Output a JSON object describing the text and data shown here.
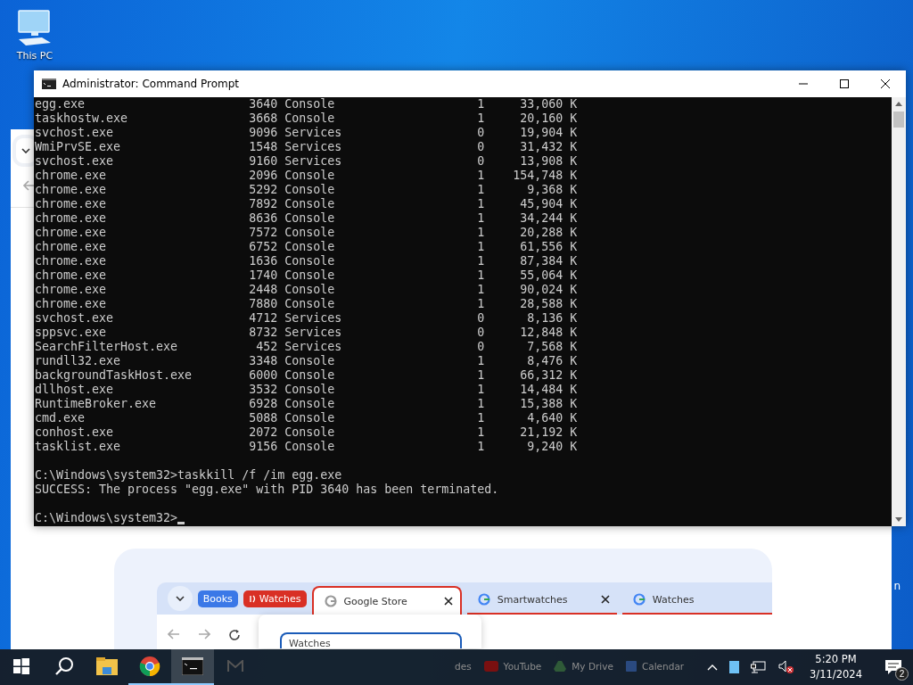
{
  "desktop": {
    "icons": [
      {
        "label": "This PC"
      }
    ]
  },
  "browser": {
    "page": {
      "tab_groups": [
        {
          "label": "Books",
          "color": "#3b78e7"
        },
        {
          "label": "Watches",
          "color": "#d93025"
        }
      ],
      "tabs": [
        {
          "title": "Google Store",
          "selected": true
        },
        {
          "title": "Smartwatches",
          "selected": false
        },
        {
          "title": "Watches",
          "selected": false
        }
      ],
      "popup_field": {
        "value": "Watches"
      },
      "bookmarks": [
        {
          "label": "des"
        },
        {
          "label": "YouTube"
        },
        {
          "label": "My Drive"
        },
        {
          "label": "Calendar"
        }
      ]
    },
    "edge_text": "n"
  },
  "cmd": {
    "title": "Administrator: Command Prompt",
    "processes": [
      {
        "name": "egg.exe",
        "pid": "3640",
        "session": "Console",
        "session_num": "1",
        "mem": "33,060 K"
      },
      {
        "name": "taskhostw.exe",
        "pid": "3668",
        "session": "Console",
        "session_num": "1",
        "mem": "20,160 K"
      },
      {
        "name": "svchost.exe",
        "pid": "9096",
        "session": "Services",
        "session_num": "0",
        "mem": "19,904 K"
      },
      {
        "name": "WmiPrvSE.exe",
        "pid": "1548",
        "session": "Services",
        "session_num": "0",
        "mem": "31,432 K"
      },
      {
        "name": "svchost.exe",
        "pid": "9160",
        "session": "Services",
        "session_num": "0",
        "mem": "13,908 K"
      },
      {
        "name": "chrome.exe",
        "pid": "2096",
        "session": "Console",
        "session_num": "1",
        "mem": "154,748 K"
      },
      {
        "name": "chrome.exe",
        "pid": "5292",
        "session": "Console",
        "session_num": "1",
        "mem": "9,368 K"
      },
      {
        "name": "chrome.exe",
        "pid": "7892",
        "session": "Console",
        "session_num": "1",
        "mem": "45,904 K"
      },
      {
        "name": "chrome.exe",
        "pid": "8636",
        "session": "Console",
        "session_num": "1",
        "mem": "34,244 K"
      },
      {
        "name": "chrome.exe",
        "pid": "7572",
        "session": "Console",
        "session_num": "1",
        "mem": "20,288 K"
      },
      {
        "name": "chrome.exe",
        "pid": "6752",
        "session": "Console",
        "session_num": "1",
        "mem": "61,556 K"
      },
      {
        "name": "chrome.exe",
        "pid": "1636",
        "session": "Console",
        "session_num": "1",
        "mem": "87,384 K"
      },
      {
        "name": "chrome.exe",
        "pid": "1740",
        "session": "Console",
        "session_num": "1",
        "mem": "55,064 K"
      },
      {
        "name": "chrome.exe",
        "pid": "2448",
        "session": "Console",
        "session_num": "1",
        "mem": "90,024 K"
      },
      {
        "name": "chrome.exe",
        "pid": "7880",
        "session": "Console",
        "session_num": "1",
        "mem": "28,588 K"
      },
      {
        "name": "svchost.exe",
        "pid": "4712",
        "session": "Services",
        "session_num": "0",
        "mem": "8,136 K"
      },
      {
        "name": "sppsvc.exe",
        "pid": "8732",
        "session": "Services",
        "session_num": "0",
        "mem": "12,848 K"
      },
      {
        "name": "SearchFilterHost.exe",
        "pid": "452",
        "session": "Services",
        "session_num": "0",
        "mem": "7,568 K"
      },
      {
        "name": "rundll32.exe",
        "pid": "3348",
        "session": "Console",
        "session_num": "1",
        "mem": "8,476 K"
      },
      {
        "name": "backgroundTaskHost.exe",
        "pid": "6000",
        "session": "Console",
        "session_num": "1",
        "mem": "66,312 K"
      },
      {
        "name": "dllhost.exe",
        "pid": "3532",
        "session": "Console",
        "session_num": "1",
        "mem": "14,484 K"
      },
      {
        "name": "RuntimeBroker.exe",
        "pid": "6928",
        "session": "Console",
        "session_num": "1",
        "mem": "15,388 K"
      },
      {
        "name": "cmd.exe",
        "pid": "5088",
        "session": "Console",
        "session_num": "1",
        "mem": "4,640 K"
      },
      {
        "name": "conhost.exe",
        "pid": "2072",
        "session": "Console",
        "session_num": "1",
        "mem": "21,192 K"
      },
      {
        "name": "tasklist.exe",
        "pid": "9156",
        "session": "Console",
        "session_num": "1",
        "mem": "9,240 K"
      }
    ],
    "output": [
      {
        "kind": "blank"
      },
      {
        "kind": "command",
        "text": "C:\\Windows\\system32>taskkill /f /im egg.exe"
      },
      {
        "kind": "message",
        "text": "SUCCESS: The process \"egg.exe\" with PID 3640 has been terminated."
      },
      {
        "kind": "blank"
      },
      {
        "kind": "prompt",
        "text": "C:\\Windows\\system32>"
      }
    ]
  },
  "taskbar": {
    "apps": [
      {
        "kind": "explorer",
        "open": false,
        "active": false
      },
      {
        "kind": "chrome",
        "open": true,
        "active": false
      },
      {
        "kind": "cmd",
        "open": true,
        "active": true
      },
      {
        "kind": "mail",
        "open": false,
        "active": false
      }
    ],
    "clock": {
      "time": "5:20 PM",
      "date": "3/11/2024"
    },
    "notification_count": "2"
  }
}
